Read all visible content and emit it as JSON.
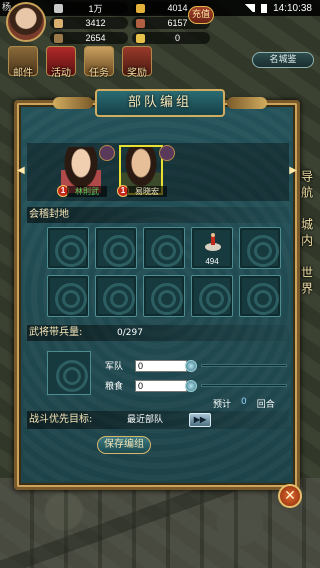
{
  "status": {
    "time": "14:10:38"
  },
  "player": {
    "name": "杨",
    "recharge_label": "充值",
    "resources": [
      {
        "icon": "silver-icon",
        "value": "1万",
        "color": "#c8c8c8"
      },
      {
        "icon": "gold-icon",
        "value": "4014",
        "color": "#e2b23a"
      },
      {
        "icon": "food-icon",
        "value": "3412",
        "color": "#d8b070"
      },
      {
        "icon": "troops-icon",
        "value": "6157",
        "color": "#b06040"
      },
      {
        "icon": "wood-icon",
        "value": "2654",
        "color": "#9a7a4a"
      },
      {
        "icon": "ingot-icon",
        "value": "0",
        "color": "#e6c24a"
      }
    ]
  },
  "top_nav": {
    "items": [
      {
        "label": "邮件",
        "icon": "mail-icon"
      },
      {
        "label": "活动",
        "icon": "event-gift-icon"
      },
      {
        "label": "任务",
        "icon": "task-scroll-icon"
      },
      {
        "label": "奖励",
        "icon": "reward-icon"
      }
    ],
    "city_button": "名城鉴"
  },
  "side_menu": [
    "导航",
    "城内",
    "世界"
  ],
  "dialog": {
    "title": "部队编组",
    "heroes": [
      {
        "name": "林則武",
        "level": "1",
        "selected": false
      },
      {
        "name": "易晓宏",
        "level": "1",
        "selected": true
      }
    ],
    "territory_label": "会稽封地",
    "troop_slot_count": "494",
    "capacity_label": "武将带兵量:",
    "capacity_value": "0/297",
    "army_label": "军队",
    "army_value": "0",
    "grain_label": "粮食",
    "grain_value": "0",
    "estimate_label": "预计",
    "estimate_value": "0",
    "rounds_label": "回合",
    "target_label": "战斗优先目标:",
    "target_value": "最近部队",
    "switch_symbol": "▶▶",
    "save_label": "保存编组",
    "close_symbol": "✕"
  }
}
